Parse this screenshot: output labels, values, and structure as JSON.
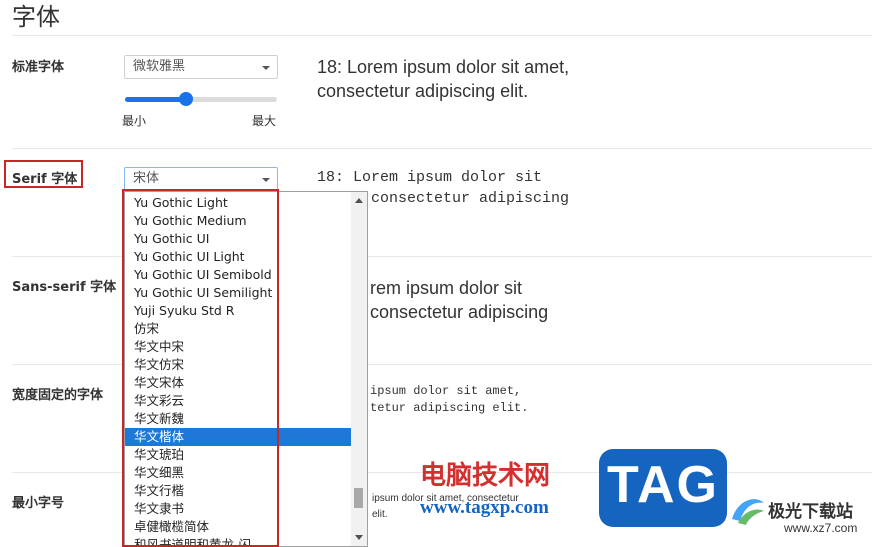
{
  "section_title": "字体",
  "standard": {
    "label": "标准字体",
    "font_value": "微软雅黑",
    "slider_min_label": "最小",
    "slider_max_label": "最大",
    "slider_level": 0.4,
    "preview": "18: Lorem ipsum dolor sit amet, consectetur adipiscing elit."
  },
  "serif": {
    "label": "Serif 字体",
    "font_value": "宋体",
    "preview": "18: Lorem ipsum dolor sit amet, consectetur adipiscing"
  },
  "sans_serif": {
    "label": "Sans-serif 字体",
    "preview": "rem ipsum dolor sit\nconsectetur adipiscing"
  },
  "fixed": {
    "label": "宽度固定的字体",
    "preview": "ipsum dolor sit amet,\ntetur adipiscing elit."
  },
  "min_size": {
    "label": "最小字号",
    "preview": "ipsum dolor sit amet, consectetur\nelit."
  },
  "dropdown": {
    "items": [
      "Yu Gothic Light",
      "Yu Gothic Medium",
      "Yu Gothic UI",
      "Yu Gothic UI Light",
      "Yu Gothic UI Semibold",
      "Yu Gothic UI Semilight",
      "Yuji Syuku Std R",
      "仿宋",
      "华文中宋",
      "华文仿宋",
      "华文宋体",
      "华文彩云",
      "华文新魏",
      "华文楷体",
      "华文琥珀",
      "华文细黑",
      "华文行楷",
      "华文隶书",
      "卓健橄榄简体",
      "和风书道明和黄龙-闪"
    ],
    "selected_index": 13
  },
  "watermark": {
    "site_cn": "电脑技术网",
    "site_url": "www.tagxp.com",
    "logo_text": "TAG",
    "brand2": "极光下载站",
    "brand2_url": "www.xz7.com"
  },
  "colors": {
    "accent": "#1a73e8",
    "highlight_red": "#c62828",
    "selection": "#1e78d7",
    "logo_blue": "#1565c0"
  }
}
